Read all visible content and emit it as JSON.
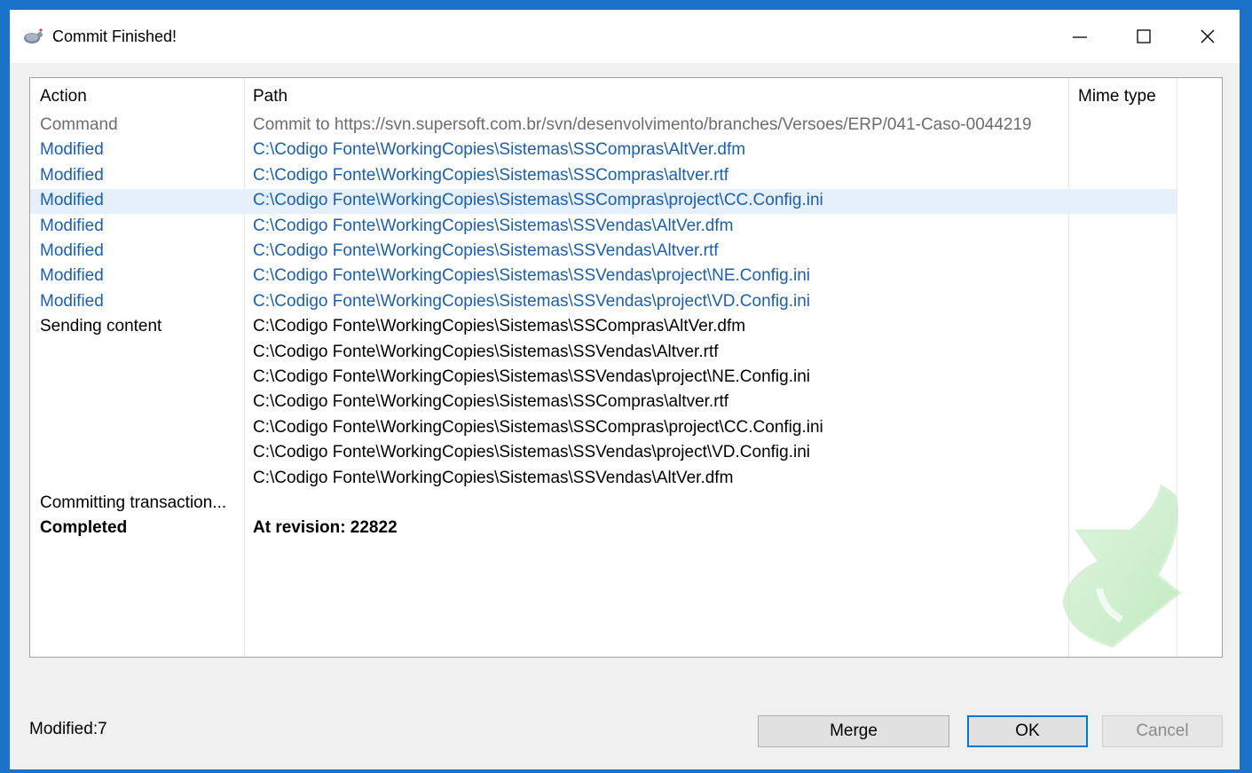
{
  "window": {
    "title": "Commit Finished!"
  },
  "table": {
    "columns": [
      "Action",
      "Path",
      "Mime type"
    ],
    "rows": [
      {
        "action": "Command",
        "path": "Commit to https://svn.supersoft.com.br/svn/desenvolvimento/branches/Versoes/ERP/041-Caso-0044219",
        "style": "gray"
      },
      {
        "action": "Modified",
        "path": "C:\\Codigo Fonte\\WorkingCopies\\Sistemas\\SSCompras\\AltVer.dfm",
        "style": "blue"
      },
      {
        "action": "Modified",
        "path": "C:\\Codigo Fonte\\WorkingCopies\\Sistemas\\SSCompras\\altver.rtf",
        "style": "blue"
      },
      {
        "action": "Modified",
        "path": "C:\\Codigo Fonte\\WorkingCopies\\Sistemas\\SSCompras\\project\\CC.Config.ini",
        "style": "blue",
        "selected": true
      },
      {
        "action": "Modified",
        "path": "C:\\Codigo Fonte\\WorkingCopies\\Sistemas\\SSVendas\\AltVer.dfm",
        "style": "blue"
      },
      {
        "action": "Modified",
        "path": "C:\\Codigo Fonte\\WorkingCopies\\Sistemas\\SSVendas\\Altver.rtf",
        "style": "blue"
      },
      {
        "action": "Modified",
        "path": "C:\\Codigo Fonte\\WorkingCopies\\Sistemas\\SSVendas\\project\\NE.Config.ini",
        "style": "blue"
      },
      {
        "action": "Modified",
        "path": "C:\\Codigo Fonte\\WorkingCopies\\Sistemas\\SSVendas\\project\\VD.Config.ini",
        "style": "blue"
      },
      {
        "action": "Sending content",
        "path": "C:\\Codigo Fonte\\WorkingCopies\\Sistemas\\SSCompras\\AltVer.dfm",
        "style": "black"
      },
      {
        "action": "",
        "path": "C:\\Codigo Fonte\\WorkingCopies\\Sistemas\\SSVendas\\Altver.rtf",
        "style": "black"
      },
      {
        "action": "",
        "path": "C:\\Codigo Fonte\\WorkingCopies\\Sistemas\\SSVendas\\project\\NE.Config.ini",
        "style": "black"
      },
      {
        "action": "",
        "path": "C:\\Codigo Fonte\\WorkingCopies\\Sistemas\\SSCompras\\altver.rtf",
        "style": "black"
      },
      {
        "action": "",
        "path": "C:\\Codigo Fonte\\WorkingCopies\\Sistemas\\SSCompras\\project\\CC.Config.ini",
        "style": "black"
      },
      {
        "action": "",
        "path": "C:\\Codigo Fonte\\WorkingCopies\\Sistemas\\SSVendas\\project\\VD.Config.ini",
        "style": "black"
      },
      {
        "action": "",
        "path": "C:\\Codigo Fonte\\WorkingCopies\\Sistemas\\SSVendas\\AltVer.dfm",
        "style": "black"
      },
      {
        "action": "Committing transaction...",
        "path": "",
        "style": "black"
      },
      {
        "action": "Completed",
        "path": "At revision: 22822",
        "style": "bold"
      }
    ]
  },
  "footer": {
    "status": "Modified:7",
    "merge_label": "Merge",
    "ok_label": "OK",
    "cancel_label": "Cancel"
  },
  "colors": {
    "link_blue": "#1a5fb0",
    "selection": "#e5f0fb",
    "accent": "#0078d7"
  },
  "icons": [
    "tortoise-svn-icon",
    "minimize-icon",
    "maximize-icon",
    "close-icon",
    "success-arrow-icon"
  ]
}
